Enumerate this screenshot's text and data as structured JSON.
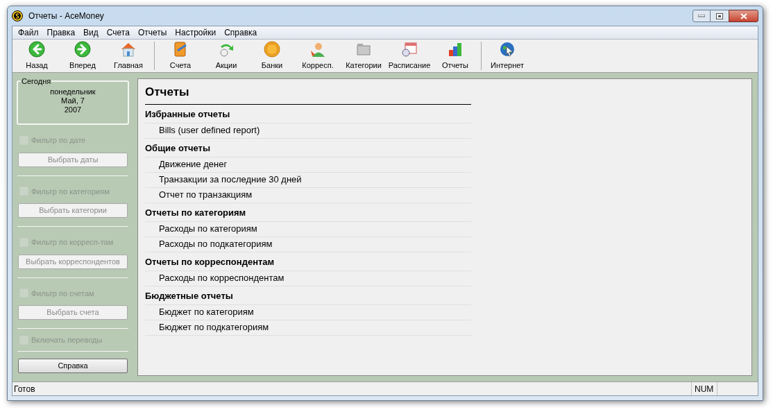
{
  "window": {
    "title": "Отчеты - AceMoney"
  },
  "menu": [
    "Файл",
    "Правка",
    "Вид",
    "Счета",
    "Отчеты",
    "Настройки",
    "Справка"
  ],
  "toolbar_groups": [
    [
      "Назад",
      "Вперед",
      "Главная"
    ],
    [
      "Счета",
      "Акции",
      "Банки",
      "Корресп.",
      "Категории",
      "Расписание",
      "Отчеты"
    ],
    [
      "Интернет"
    ]
  ],
  "today": {
    "title": "Сегодня",
    "lines": [
      "понедельник",
      "Май, 7",
      "2007"
    ]
  },
  "filters": [
    {
      "label": "Фильтр по дате",
      "checked": false,
      "disabled": true,
      "button": "Выбрать даты"
    },
    {
      "label": "Фильтр по категориям",
      "checked": false,
      "disabled": true,
      "button": "Выбрать категории"
    },
    {
      "label": "Фильтр по корресп-там",
      "checked": false,
      "disabled": true,
      "button": "Выбрать корреспондентов"
    },
    {
      "label": "Фильтр по счетам",
      "checked": false,
      "disabled": true,
      "button": "Выбрать счета"
    }
  ],
  "include_transfers": {
    "label": "Включать переводы",
    "checked": false,
    "disabled": true
  },
  "help_button": "Справка",
  "reports": {
    "title": "Отчеты",
    "sections": [
      {
        "title": "Избранные отчеты",
        "items": [
          "Bills (user defined report)"
        ]
      },
      {
        "title": "Общие отчеты",
        "items": [
          "Движение денег",
          "Транзакции за последние 30 дней",
          "Отчет по транзакциям"
        ]
      },
      {
        "title": "Отчеты по категориям",
        "items": [
          "Расходы по категориям",
          "Расходы по подкатегориям"
        ]
      },
      {
        "title": "Отчеты по корреспондентам",
        "items": [
          "Расходы по корреспондентам"
        ]
      },
      {
        "title": "Бюджетные отчеты",
        "items": [
          "Бюджет по категориям",
          "Бюджет по подкатегориям"
        ]
      }
    ]
  },
  "status_bar": {
    "text": "Готов",
    "num": "NUM"
  }
}
